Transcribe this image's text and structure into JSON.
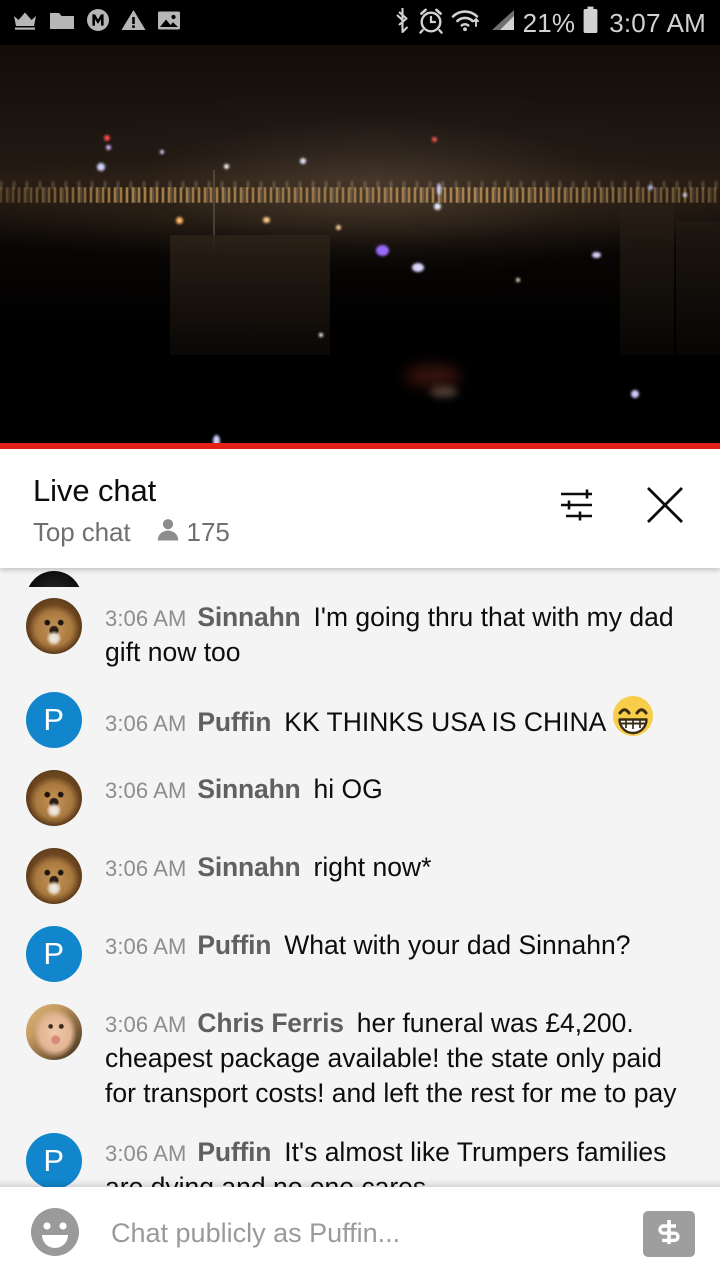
{
  "status_bar": {
    "left_icons": [
      "crown-icon",
      "folder-icon",
      "m-circle-icon",
      "warning-triangle-icon",
      "image-icon"
    ],
    "right_icons": [
      "bluetooth-icon",
      "alarm-clock-icon",
      "wifi-icon",
      "signal-bars-icon",
      "battery-icon"
    ],
    "battery_percent": "21%",
    "clock": "3:07 AM",
    "background_color": "#000000",
    "foreground_color": "#d2d2d2"
  },
  "video": {
    "description": "night-time cityscape live stream",
    "progress_color": "#e62117",
    "background_color": "#000000"
  },
  "header": {
    "title": "Live chat",
    "subtitle": "Top chat",
    "viewer_icon": "person-icon",
    "viewer_count": "175",
    "settings_icon": "tune-sliders-icon",
    "close_icon": "close-icon"
  },
  "messages": [
    {
      "avatar_type": "dark",
      "avatar_label": "",
      "avatar_color": "#141414",
      "time": "",
      "author": "",
      "text": "",
      "clipped": true
    },
    {
      "avatar_type": "lion",
      "avatar_label": "",
      "avatar_color": "#8a5f2e",
      "time": "3:06 AM",
      "author": "Sinnahn",
      "text": "I'm going thru that with my dad gift now too"
    },
    {
      "avatar_type": "initial",
      "avatar_label": "P",
      "avatar_color": "#1186cc",
      "time": "3:06 AM",
      "author": "Puffin",
      "text": "KK THINKS USA IS CHINA",
      "emoji": "grinning-face-with-smiling-eyes"
    },
    {
      "avatar_type": "lion",
      "avatar_label": "",
      "avatar_color": "#8a5f2e",
      "time": "3:06 AM",
      "author": "Sinnahn",
      "text": "hi OG"
    },
    {
      "avatar_type": "lion",
      "avatar_label": "",
      "avatar_color": "#8a5f2e",
      "time": "3:06 AM",
      "author": "Sinnahn",
      "text": "right now*"
    },
    {
      "avatar_type": "initial",
      "avatar_label": "P",
      "avatar_color": "#1186cc",
      "time": "3:06 AM",
      "author": "Puffin",
      "text": "What with your dad Sinnahn?"
    },
    {
      "avatar_type": "child",
      "avatar_label": "",
      "avatar_color": "#c79f64",
      "time": "3:06 AM",
      "author": "Chris Ferris",
      "text": "her funeral was £4,200. cheapest package available! the state only paid for transport costs! and left the rest for me to pay"
    },
    {
      "avatar_type": "initial",
      "avatar_label": "P",
      "avatar_color": "#1186cc",
      "time": "3:06 AM",
      "author": "Puffin",
      "text": "It's almost like Trumpers families are dying and no one cares"
    }
  ],
  "input_bar": {
    "emoji_icon": "emoji-smiley-icon",
    "placeholder": "Chat publicly as Puffin...",
    "value": "",
    "superchat_icon": "dollar-sign-icon",
    "superchat_color": "#9e9e9e"
  }
}
